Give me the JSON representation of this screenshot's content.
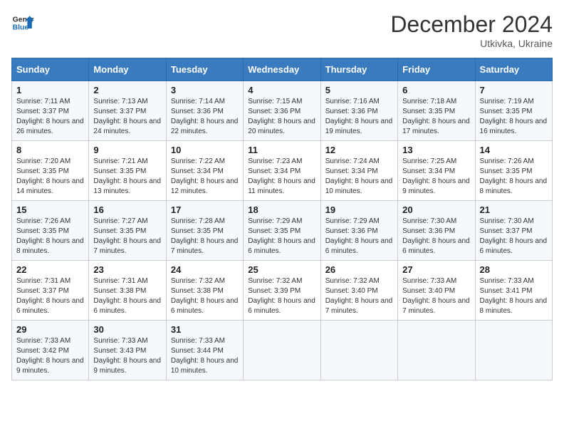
{
  "header": {
    "logo_line1": "General",
    "logo_line2": "Blue",
    "month": "December 2024",
    "location": "Utkivka, Ukraine"
  },
  "weekdays": [
    "Sunday",
    "Monday",
    "Tuesday",
    "Wednesday",
    "Thursday",
    "Friday",
    "Saturday"
  ],
  "weeks": [
    [
      {
        "day": "1",
        "sunrise": "7:11 AM",
        "sunset": "3:37 PM",
        "daylight": "8 hours and 26 minutes."
      },
      {
        "day": "2",
        "sunrise": "7:13 AM",
        "sunset": "3:37 PM",
        "daylight": "8 hours and 24 minutes."
      },
      {
        "day": "3",
        "sunrise": "7:14 AM",
        "sunset": "3:36 PM",
        "daylight": "8 hours and 22 minutes."
      },
      {
        "day": "4",
        "sunrise": "7:15 AM",
        "sunset": "3:36 PM",
        "daylight": "8 hours and 20 minutes."
      },
      {
        "day": "5",
        "sunrise": "7:16 AM",
        "sunset": "3:36 PM",
        "daylight": "8 hours and 19 minutes."
      },
      {
        "day": "6",
        "sunrise": "7:18 AM",
        "sunset": "3:35 PM",
        "daylight": "8 hours and 17 minutes."
      },
      {
        "day": "7",
        "sunrise": "7:19 AM",
        "sunset": "3:35 PM",
        "daylight": "8 hours and 16 minutes."
      }
    ],
    [
      {
        "day": "8",
        "sunrise": "7:20 AM",
        "sunset": "3:35 PM",
        "daylight": "8 hours and 14 minutes."
      },
      {
        "day": "9",
        "sunrise": "7:21 AM",
        "sunset": "3:35 PM",
        "daylight": "8 hours and 13 minutes."
      },
      {
        "day": "10",
        "sunrise": "7:22 AM",
        "sunset": "3:34 PM",
        "daylight": "8 hours and 12 minutes."
      },
      {
        "day": "11",
        "sunrise": "7:23 AM",
        "sunset": "3:34 PM",
        "daylight": "8 hours and 11 minutes."
      },
      {
        "day": "12",
        "sunrise": "7:24 AM",
        "sunset": "3:34 PM",
        "daylight": "8 hours and 10 minutes."
      },
      {
        "day": "13",
        "sunrise": "7:25 AM",
        "sunset": "3:34 PM",
        "daylight": "8 hours and 9 minutes."
      },
      {
        "day": "14",
        "sunrise": "7:26 AM",
        "sunset": "3:35 PM",
        "daylight": "8 hours and 8 minutes."
      }
    ],
    [
      {
        "day": "15",
        "sunrise": "7:26 AM",
        "sunset": "3:35 PM",
        "daylight": "8 hours and 8 minutes."
      },
      {
        "day": "16",
        "sunrise": "7:27 AM",
        "sunset": "3:35 PM",
        "daylight": "8 hours and 7 minutes."
      },
      {
        "day": "17",
        "sunrise": "7:28 AM",
        "sunset": "3:35 PM",
        "daylight": "8 hours and 7 minutes."
      },
      {
        "day": "18",
        "sunrise": "7:29 AM",
        "sunset": "3:35 PM",
        "daylight": "8 hours and 6 minutes."
      },
      {
        "day": "19",
        "sunrise": "7:29 AM",
        "sunset": "3:36 PM",
        "daylight": "8 hours and 6 minutes."
      },
      {
        "day": "20",
        "sunrise": "7:30 AM",
        "sunset": "3:36 PM",
        "daylight": "8 hours and 6 minutes."
      },
      {
        "day": "21",
        "sunrise": "7:30 AM",
        "sunset": "3:37 PM",
        "daylight": "8 hours and 6 minutes."
      }
    ],
    [
      {
        "day": "22",
        "sunrise": "7:31 AM",
        "sunset": "3:37 PM",
        "daylight": "8 hours and 6 minutes."
      },
      {
        "day": "23",
        "sunrise": "7:31 AM",
        "sunset": "3:38 PM",
        "daylight": "8 hours and 6 minutes."
      },
      {
        "day": "24",
        "sunrise": "7:32 AM",
        "sunset": "3:38 PM",
        "daylight": "8 hours and 6 minutes."
      },
      {
        "day": "25",
        "sunrise": "7:32 AM",
        "sunset": "3:39 PM",
        "daylight": "8 hours and 6 minutes."
      },
      {
        "day": "26",
        "sunrise": "7:32 AM",
        "sunset": "3:40 PM",
        "daylight": "8 hours and 7 minutes."
      },
      {
        "day": "27",
        "sunrise": "7:33 AM",
        "sunset": "3:40 PM",
        "daylight": "8 hours and 7 minutes."
      },
      {
        "day": "28",
        "sunrise": "7:33 AM",
        "sunset": "3:41 PM",
        "daylight": "8 hours and 8 minutes."
      }
    ],
    [
      {
        "day": "29",
        "sunrise": "7:33 AM",
        "sunset": "3:42 PM",
        "daylight": "8 hours and 9 minutes."
      },
      {
        "day": "30",
        "sunrise": "7:33 AM",
        "sunset": "3:43 PM",
        "daylight": "8 hours and 9 minutes."
      },
      {
        "day": "31",
        "sunrise": "7:33 AM",
        "sunset": "3:44 PM",
        "daylight": "8 hours and 10 minutes."
      },
      null,
      null,
      null,
      null
    ]
  ],
  "labels": {
    "sunrise": "Sunrise:",
    "sunset": "Sunset:",
    "daylight": "Daylight:"
  }
}
